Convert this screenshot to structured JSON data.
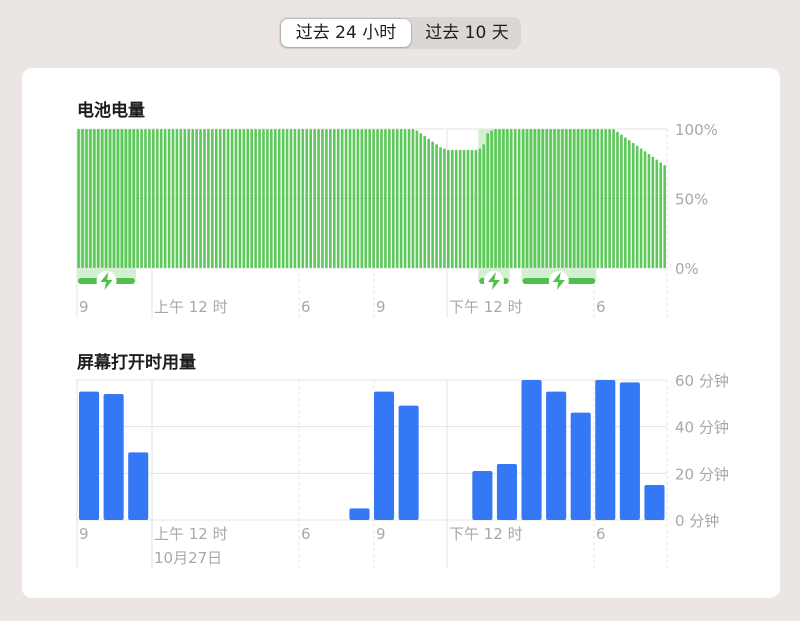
{
  "segmented": {
    "options": [
      "过去 24 小时",
      "过去 10 天"
    ],
    "selected": 0
  },
  "colors": {
    "battery_bar": "#5cc95a",
    "battery_charging_bg": "#d3f1d1",
    "charging_indicator": "#4fc04c",
    "screen_bar": "#3478f6",
    "gridline": "#e3e3e3",
    "tick_label": "#a8a8a8"
  },
  "battery": {
    "title": "电池电量",
    "charging_icon": "bolt-icon"
  },
  "screen": {
    "title": "屏幕打开时用量"
  },
  "chart_data": [
    {
      "type": "bar",
      "name": "battery-level",
      "title": "电池电量",
      "x_tick_labels": [
        "9",
        "上午 12 时",
        "6",
        "9",
        "下午 12 时",
        "6"
      ],
      "y_tick_labels": [
        "100%",
        "50%",
        "0%"
      ],
      "ylim": [
        0,
        100
      ],
      "grid": true,
      "values": [
        100,
        100,
        100,
        100,
        100,
        100,
        100,
        100,
        100,
        100,
        100,
        100,
        100,
        100,
        100,
        100,
        100,
        100,
        100,
        100,
        100,
        100,
        100,
        100,
        100,
        100,
        100,
        100,
        100,
        100,
        100,
        100,
        100,
        100,
        100,
        100,
        100,
        100,
        100,
        100,
        100,
        100,
        100,
        100,
        100,
        100,
        100,
        100,
        100,
        100,
        100,
        100,
        100,
        100,
        100,
        100,
        100,
        100,
        100,
        100,
        100,
        100,
        100,
        100,
        100,
        100,
        100,
        100,
        100,
        100,
        100,
        100,
        100,
        100,
        100,
        100,
        100,
        100,
        100,
        100,
        100,
        100,
        100,
        100,
        100,
        100,
        99,
        97,
        95,
        93,
        91,
        89,
        87,
        86,
        85,
        85,
        85,
        85,
        85,
        85,
        85,
        85,
        86,
        89,
        97,
        99,
        100,
        100,
        100,
        100,
        100,
        100,
        100,
        100,
        100,
        100,
        100,
        100,
        100,
        100,
        100,
        100,
        100,
        100,
        100,
        100,
        100,
        100,
        100,
        100,
        100,
        100,
        100,
        100,
        100,
        100,
        100,
        98,
        96,
        94,
        92,
        90,
        88,
        86,
        84,
        82,
        80,
        78,
        76,
        74
      ],
      "charging_periods": [
        [
          0,
          15
        ],
        [
          102,
          110
        ],
        [
          113,
          132
        ]
      ]
    },
    {
      "type": "bar",
      "name": "screen-on-usage",
      "title": "屏幕打开时用量",
      "x_tick_labels": [
        "9",
        "上午 12 时",
        "6",
        "9",
        "下午 12 时",
        "6"
      ],
      "x_sub_label": "10月27日",
      "y_tick_labels": [
        "60 分钟",
        "40 分钟",
        "20 分钟",
        "0 分钟"
      ],
      "ylim": [
        0,
        60
      ],
      "grid": true,
      "values": [
        55,
        54,
        29,
        0,
        0,
        0,
        0,
        0,
        0,
        0,
        0,
        5,
        55,
        49,
        0,
        0,
        21,
        24,
        60,
        55,
        46,
        60,
        59,
        15
      ]
    }
  ]
}
